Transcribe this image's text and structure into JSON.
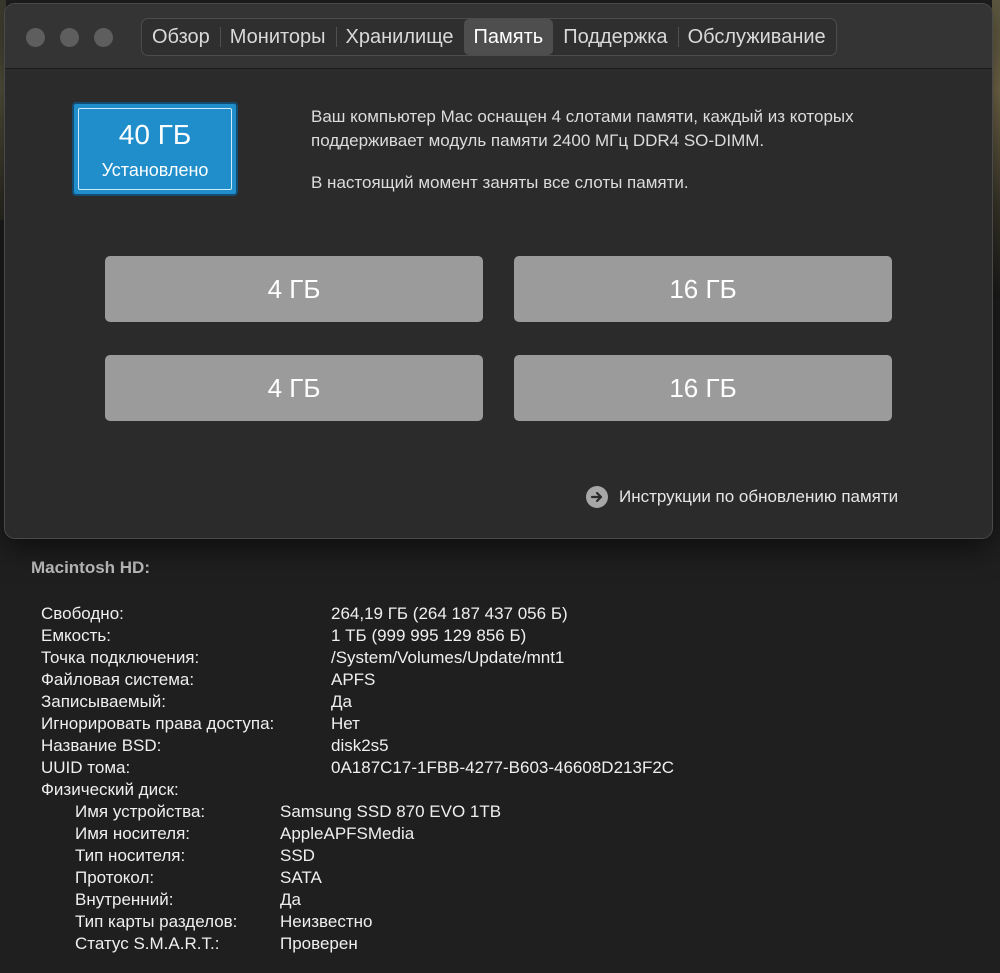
{
  "window": {
    "tabs": [
      "Обзор",
      "Мониторы",
      "Хранилище",
      "Память",
      "Поддержка",
      "Обслуживание"
    ],
    "active_tab": "Память"
  },
  "memory": {
    "installed_size": "40 ГБ",
    "installed_label": "Установлено",
    "description": "Ваш компьютер Mac оснащен 4 слотами памяти, каждый из которых поддерживает модуль памяти 2400 МГц DDR4 SO-DIMM.",
    "status": "В настоящий момент заняты все слоты памяти.",
    "slots": [
      "4 ГБ",
      "16 ГБ",
      "4 ГБ",
      "16 ГБ"
    ],
    "upgrade_link": "Инструкции по обновлению памяти"
  },
  "volume": {
    "title": "Macintosh HD:",
    "rows": [
      {
        "key": "Свободно:",
        "value": "264,19 ГБ (264 187 437 056 Б)"
      },
      {
        "key": "Емкость:",
        "value": "1 ТБ (999 995 129 856 Б)"
      },
      {
        "key": "Точка подключения:",
        "value": "/System/Volumes/Update/mnt1"
      },
      {
        "key": "Файловая система:",
        "value": "APFS"
      },
      {
        "key": "Записываемый:",
        "value": "Да"
      },
      {
        "key": "Игнорировать права доступа:",
        "value": "Нет"
      },
      {
        "key": "Название BSD:",
        "value": "disk2s5"
      },
      {
        "key": "UUID тома:",
        "value": "0A187C17-1FBB-4277-B603-46608D213F2C"
      },
      {
        "key": "Физический диск:",
        "value": ""
      }
    ],
    "disk_rows": [
      {
        "key": "Имя устройства:",
        "value": "Samsung SSD 870 EVO 1TB"
      },
      {
        "key": "Имя носителя:",
        "value": "AppleAPFSMedia"
      },
      {
        "key": "Тип носителя:",
        "value": "SSD"
      },
      {
        "key": "Протокол:",
        "value": "SATA"
      },
      {
        "key": "Внутренний:",
        "value": "Да"
      },
      {
        "key": "Тип карты разделов:",
        "value": "Неизвестно"
      },
      {
        "key": "Статус S.M.A.R.T.:",
        "value": "Проверен"
      }
    ]
  },
  "colors": {
    "badge": "#1f8ecb",
    "slot": "#9b9b9b",
    "window": "#2b2b2b"
  }
}
